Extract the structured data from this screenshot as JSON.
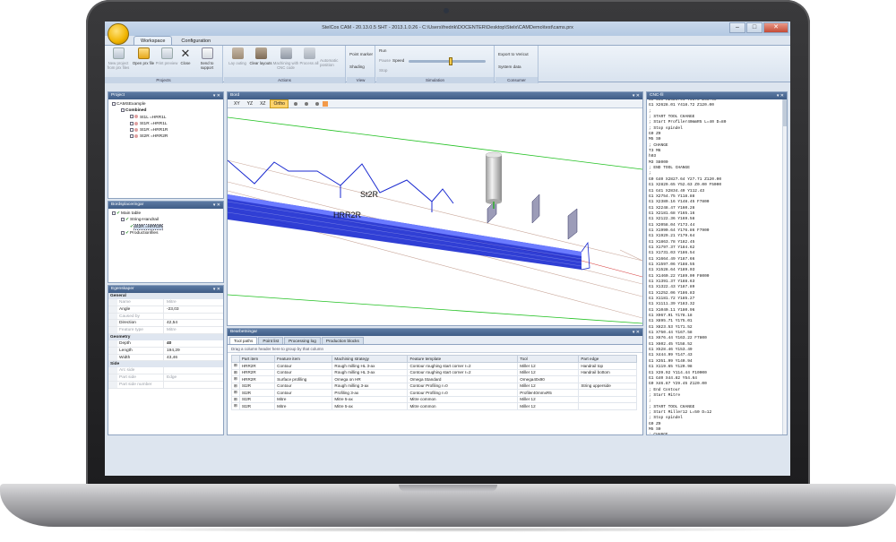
{
  "window": {
    "title": "StelCos CAM - 20.13.0.5 SHT - 2013.1.0.26 - C:\\Users\\fredrik\\DOCENTER\\Desktop\\Stelx\\CAMDemo\\test\\cams.prx",
    "controls": [
      "–",
      "□",
      "✕"
    ]
  },
  "menu_tabs": [
    {
      "label": "Workspace",
      "active": true
    },
    {
      "label": "Configuration",
      "active": false
    }
  ],
  "ribbon": {
    "projects": {
      "caption": "Projects",
      "buttons": [
        {
          "label": "New project from prx files",
          "enabled": false,
          "icon": "new-project-icon"
        },
        {
          "label": "Open prx file",
          "enabled": true,
          "icon": "open-folder-icon"
        },
        {
          "label": "Print preview",
          "enabled": false,
          "icon": "print-icon"
        },
        {
          "label": "Close",
          "enabled": true,
          "icon": "close-x-icon"
        },
        {
          "label": "Send to support",
          "enabled": true,
          "icon": "mail-icon"
        }
      ]
    },
    "actions": {
      "caption": "Actions",
      "buttons": [
        {
          "label": "Lay outing",
          "enabled": false,
          "icon": "layout-icon"
        },
        {
          "label": "Clear layouts",
          "enabled": true,
          "icon": "clear-layouts-icon"
        },
        {
          "label": "Machining with CNC code",
          "enabled": false,
          "icon": "machining-icon"
        },
        {
          "label": "Process all",
          "enabled": false,
          "icon": "process-icon"
        },
        {
          "label": "Automatic position",
          "enabled": false,
          "icon": "position-icon"
        }
      ]
    },
    "view": {
      "caption": "View",
      "items": [
        "Point marker",
        "Shading"
      ]
    },
    "simulation": {
      "caption": "Simulation",
      "items": [
        "Run",
        "Pause",
        "Stop"
      ],
      "speed_label": "Speed",
      "speed_level": 0.55
    },
    "consumer": {
      "caption": "Consumer",
      "items": [
        "Export to Vericut",
        "System data"
      ]
    }
  },
  "project_panel": {
    "title": "Project",
    "items": [
      {
        "label": "CAMSExample",
        "level": 0
      },
      {
        "label": "Combined",
        "level": 1,
        "bold": true
      },
      {
        "label": "St1L =HRR1L",
        "level": 2,
        "color": "#e0a0a0"
      },
      {
        "label": "St1R =HRR1L",
        "level": 2,
        "color": "#e0a0a0"
      },
      {
        "label": "St1R =HRR1R",
        "level": 2,
        "color": "#e0a0a0"
      },
      {
        "label": "St2R =HRR2R",
        "level": 2,
        "color": "#e0a0a0"
      }
    ]
  },
  "tree_panel": {
    "title": "Bordsplaceringar",
    "items": [
      {
        "label": "Main table",
        "level": 0
      },
      {
        "label": "String-Handrail",
        "level": 1
      },
      {
        "label": "St2R =HRR2R",
        "level": 2,
        "selected": true
      },
      {
        "label": "Productionfiles",
        "level": 1
      }
    ]
  },
  "properties_panel": {
    "title": "Egenskaper",
    "sections": [
      {
        "name": "General",
        "rows": [
          {
            "key": "Name",
            "value": "Mitre",
            "enabled": false
          },
          {
            "key": "Angle",
            "value": "-23,03",
            "enabled": true
          },
          {
            "key": "Caused by",
            "value": "",
            "enabled": false
          },
          {
            "key": "Direction",
            "value": "42,54",
            "enabled": true
          },
          {
            "key": "Feature type",
            "value": "Mitre",
            "enabled": false
          }
        ]
      },
      {
        "name": "Geometry",
        "rows": [
          {
            "key": "Depth",
            "value": "40",
            "enabled": true
          },
          {
            "key": "Length",
            "value": "194,29",
            "enabled": true
          },
          {
            "key": "Width",
            "value": "43,46",
            "enabled": true
          }
        ]
      },
      {
        "name": "Side",
        "rows": [
          {
            "key": "Arc side",
            "value": "",
            "enabled": false
          },
          {
            "key": "Part side",
            "value": "Edge",
            "enabled": false
          },
          {
            "key": "Part side number",
            "value": "",
            "enabled": false
          }
        ]
      }
    ]
  },
  "viewport": {
    "title": "Bord",
    "view_buttons": [
      {
        "label": "XY",
        "active": false
      },
      {
        "label": "YZ",
        "active": false
      },
      {
        "label": "XZ",
        "active": false
      },
      {
        "label": "Ortho",
        "active": true
      }
    ],
    "labels": [
      "St2R",
      "HRR2R"
    ]
  },
  "bottom_panel": {
    "title": "Bearbetningar",
    "tabs": [
      {
        "label": "Tool paths",
        "active": true
      },
      {
        "label": "Point list",
        "active": false
      },
      {
        "label": "Processing log",
        "active": false
      },
      {
        "label": "Production blocks",
        "active": false
      }
    ],
    "group_hint": "Drag a column header here to group by that column",
    "columns": [
      "Part item",
      "Feature item",
      "Machining strategy",
      "Feature template",
      "Tool",
      "Part edge"
    ],
    "rows": [
      [
        "HRR2R",
        "Contour",
        "Rough milling HL 3-ax",
        "Contour roughing start corner r=2",
        "Miller 12",
        "Handrail top"
      ],
      [
        "HRR2R",
        "Contour",
        "Rough milling HL 3-ax",
        "Contour roughing start corner r=2",
        "Miller 12",
        "Handrail bottom"
      ],
      [
        "HRR2R",
        "Surface profiling",
        "Omega on HR",
        "Omega Standard",
        "Omega40x90",
        ""
      ],
      [
        "St2R",
        "Contour",
        "Rough milling 3-ax",
        "Contour Profiling r=0",
        "Miller 12",
        "String upperside"
      ],
      [
        "St2R",
        "Contour",
        "Profiling 3-ax",
        "Contour Profiling r=0",
        "Profiler40mmxR5",
        ""
      ],
      [
        "St2R",
        "Mitre",
        "Mitre 5-ax",
        "Mitre common",
        "Miller 12",
        ""
      ],
      [
        "St2R",
        "Mitre",
        "Mitre 5-ax",
        "Mitre common",
        "Miller 12",
        ""
      ]
    ]
  },
  "nc_panel": {
    "title": "CNC-fil",
    "lines": [
      "G0 G40 X2626.94 Y55.0 Z55.00",
      "G1 X2628.01 Y418.72 Z120.00",
      ";",
      "; START TOOL CHANGE",
      "; Start Profiler40mmR5 L=40 D=80",
      "; Stop spindel",
      "G0 Z0",
      "M5 S0",
      "; CHANGE",
      "T3 M6",
      "h03",
      "M3 S8000",
      "; END TOOL CHANGE",
      ";",
      "G0 G40 X2827.64 Y27.71 Z120.00",
      "G1 X2829.65 Y52.63 Z0.00 F5000",
      "G1 G41 X2834.49 Y112.43",
      "G1 X2754.75 Y118.88",
      "G1 X2389.16 Y148.45 F7800",
      "G1 X2248.47 Y160.28",
      "G1 X2181.68 Y165.16",
      "G1 X2122.36 Y169.58",
      "G1 X2058.04 Y173.44",
      "G1 X1990.64 Y176.86 F7900",
      "G1 X1929.21 Y179.64",
      "G1 X1863.78 Y182.45",
      "G1 X1797.37 Y184.62",
      "G1 X1731.03 Y186.54",
      "G1 X1664.49 Y187.66",
      "G1 X1597.06 Y188.55",
      "G1 X1528.64 Y189.03",
      "G1 X1460.22 Y189.09 F8000",
      "G1 X1391.37 Y188.63",
      "G1 X1322.43 Y187.89",
      "G1 X1252.06 Y186.83",
      "G1 X1181.72 Y185.27",
      "G1 X1111.39 Y183.32",
      "G1 X1040.11 Y180.96",
      "G1 X967.91 Y178.18",
      "G1 X895.71 Y175.01",
      "G1 X823.53 Y171.52",
      "G1 X750.44 Y167.58",
      "G1 X676.44 Y163.22 F7800",
      "G1 X602.45 Y158.52",
      "G1 X528.46 Y153.49",
      "G1 X444.99 Y147.43",
      "G1 X351.99 Y140.94",
      "G1 X119.65 Y120.98",
      "G1 X39.92 Y114.44 F10000",
      "G1 G40 X44.82 Y54.64",
      "G0 X46.87 Y29.45 Z120.00",
      "; End Contour",
      "; Start Mitre",
      ";",
      "; START TOOL CHANGE",
      "; Start Miller12 L=50 D=12",
      "; Stop spindel",
      "G0 Z0",
      "M5 S0",
      "; CHANGE",
      "T1 M6",
      "h01"
    ]
  }
}
